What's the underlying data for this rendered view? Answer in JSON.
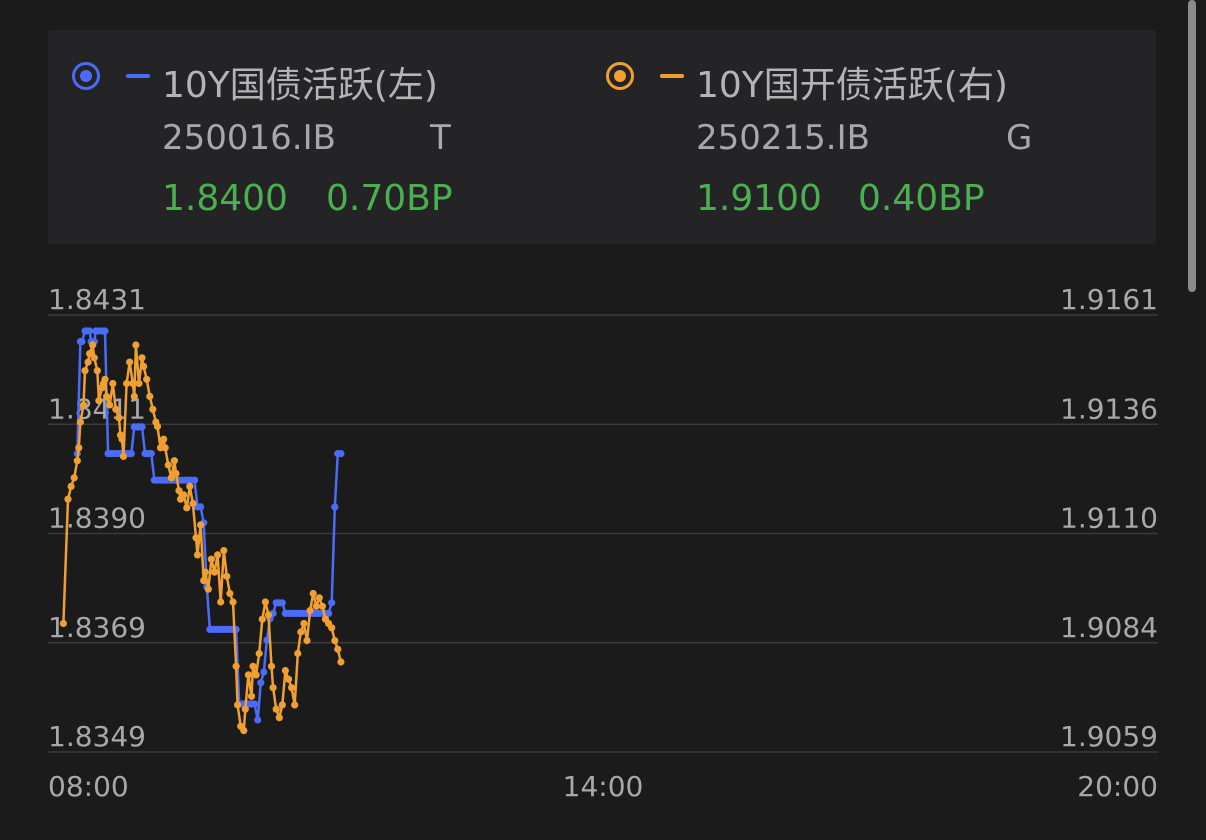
{
  "legend": {
    "left": {
      "name": "10Y国债活跃(左)",
      "code": "250016.IB",
      "tag": "T",
      "value": "1.8400",
      "change": "0.70BP",
      "color": "#4a6cf7"
    },
    "right": {
      "name": "10Y国开债活跃(右)",
      "code": "250215.IB",
      "tag": "G",
      "value": "1.9100",
      "change": "0.40BP",
      "color": "#f0a030"
    }
  },
  "chart_data": {
    "type": "line",
    "x_unit": "minutes since 08:00",
    "xlim": [
      0,
      720
    ],
    "x_tick_labels": [
      "08:00",
      "14:00",
      "20:00"
    ],
    "y_left": {
      "ticks": [
        "1.8431",
        "1.8411",
        "1.8390",
        "1.8369",
        "1.8349"
      ],
      "ylim": [
        1.8349,
        1.8431
      ]
    },
    "y_right": {
      "ticks": [
        "1.9161",
        "1.9136",
        "1.9110",
        "1.9084",
        "1.9059"
      ],
      "ylim": [
        1.9059,
        1.9161
      ]
    },
    "grid": true,
    "series": [
      {
        "name": "10Y国债活跃(左)",
        "axis": "left",
        "color": "#4a6cf7",
        "x": [
          19,
          21,
          22,
          24,
          25,
          27,
          28,
          30,
          31,
          33,
          35,
          36,
          37,
          39,
          41,
          43,
          45,
          47,
          49,
          51,
          53,
          54,
          56,
          58,
          59,
          61,
          63,
          65,
          67,
          69,
          71,
          73,
          75,
          77,
          79,
          81,
          83,
          85,
          87,
          89,
          91,
          93,
          95,
          97,
          99,
          101,
          103,
          105,
          106,
          108,
          110,
          112,
          114,
          116,
          118,
          120,
          122,
          124,
          126,
          128,
          130,
          132,
          134,
          136,
          138,
          140,
          142,
          144,
          146,
          148,
          150,
          152,
          154,
          156,
          158,
          160,
          162,
          164,
          166,
          168,
          170,
          172,
          174,
          176,
          178,
          180,
          182,
          184,
          186,
          188,
          190
        ],
        "y": [
          1.8405,
          1.8426,
          1.8426,
          1.8428,
          1.8428,
          1.8428,
          1.8426,
          1.8426,
          1.8428,
          1.8428,
          1.8428,
          1.8428,
          1.8428,
          1.8405,
          1.8405,
          1.8405,
          1.8405,
          1.8405,
          1.8405,
          1.8405,
          1.8405,
          1.8405,
          1.841,
          1.841,
          1.841,
          1.841,
          1.8405,
          1.8405,
          1.8405,
          1.84,
          1.84,
          1.84,
          1.84,
          1.84,
          1.84,
          1.84,
          1.84,
          1.84,
          1.84,
          1.84,
          1.84,
          1.84,
          1.84,
          1.8395,
          1.8395,
          1.8392,
          1.838,
          1.8372,
          1.8372,
          1.8372,
          1.8372,
          1.8372,
          1.8372,
          1.8372,
          1.8372,
          1.8372,
          1.8372,
          1.8358,
          1.8358,
          1.8358,
          1.8358,
          1.8358,
          1.8358,
          1.8355,
          1.8362,
          1.8364,
          1.837,
          1.8374,
          1.8375,
          1.8377,
          1.8377,
          1.8377,
          1.8375,
          1.8375,
          1.8375,
          1.8375,
          1.8375,
          1.8375,
          1.8375,
          1.8375,
          1.8375,
          1.8375,
          1.8375,
          1.8375,
          1.8375,
          1.8375,
          1.8375,
          1.8377,
          1.8395,
          1.8405,
          1.8405
        ]
      },
      {
        "name": "10Y国开债活跃(右)",
        "axis": "right",
        "color": "#f0a030",
        "x": [
          10,
          13,
          15,
          17,
          19,
          20,
          21,
          23,
          24,
          26,
          27,
          29,
          30,
          32,
          33,
          35,
          36,
          37,
          38,
          40,
          42,
          44,
          46,
          47,
          48,
          49,
          51,
          53,
          55,
          56,
          57,
          59,
          61,
          62,
          64,
          66,
          68,
          70,
          71,
          73,
          75,
          76,
          78,
          80,
          82,
          83,
          85,
          86,
          88,
          90,
          92,
          94,
          96,
          97,
          99,
          101,
          102,
          104,
          106,
          108,
          110,
          112,
          114,
          116,
          118,
          120,
          122,
          123,
          125,
          127,
          128,
          130,
          132,
          133,
          135,
          137,
          139,
          141,
          143,
          145,
          146,
          148,
          150,
          152,
          154,
          156,
          158,
          160,
          162,
          164,
          166,
          168,
          170,
          172,
          174,
          176,
          178,
          180,
          182,
          184,
          186,
          188,
          190
        ],
        "y": [
          1.9089,
          1.9118,
          1.9121,
          1.9123,
          1.9127,
          1.913,
          1.9136,
          1.914,
          1.9148,
          1.915,
          1.9152,
          1.9154,
          1.9151,
          1.9148,
          1.9141,
          1.9144,
          1.9145,
          1.9146,
          1.9142,
          1.914,
          1.9145,
          1.9139,
          1.9137,
          1.9133,
          1.9132,
          1.9128,
          1.9145,
          1.915,
          1.9145,
          1.9142,
          1.9154,
          1.9145,
          1.9151,
          1.9149,
          1.9146,
          1.9142,
          1.9139,
          1.9136,
          1.9135,
          1.913,
          1.9132,
          1.913,
          1.9126,
          1.9123,
          1.9127,
          1.9124,
          1.912,
          1.9118,
          1.9119,
          1.9116,
          1.9121,
          1.9117,
          1.9109,
          1.9105,
          1.9112,
          1.9099,
          1.9101,
          1.9097,
          1.9104,
          1.9101,
          1.9105,
          1.9094,
          1.9106,
          1.91,
          1.9096,
          1.9094,
          1.9079,
          1.907,
          1.9065,
          1.9064,
          1.9069,
          1.9077,
          1.9072,
          1.9079,
          1.9077,
          1.9082,
          1.909,
          1.9094,
          1.9091,
          1.9079,
          1.9074,
          1.9069,
          1.9067,
          1.907,
          1.9078,
          1.9076,
          1.9074,
          1.907,
          1.9082,
          1.9087,
          1.9089,
          1.9085,
          1.9092,
          1.9096,
          1.9093,
          1.9095,
          1.9093,
          1.909,
          1.9089,
          1.9088,
          1.9085,
          1.9083,
          1.908
        ]
      }
    ]
  }
}
